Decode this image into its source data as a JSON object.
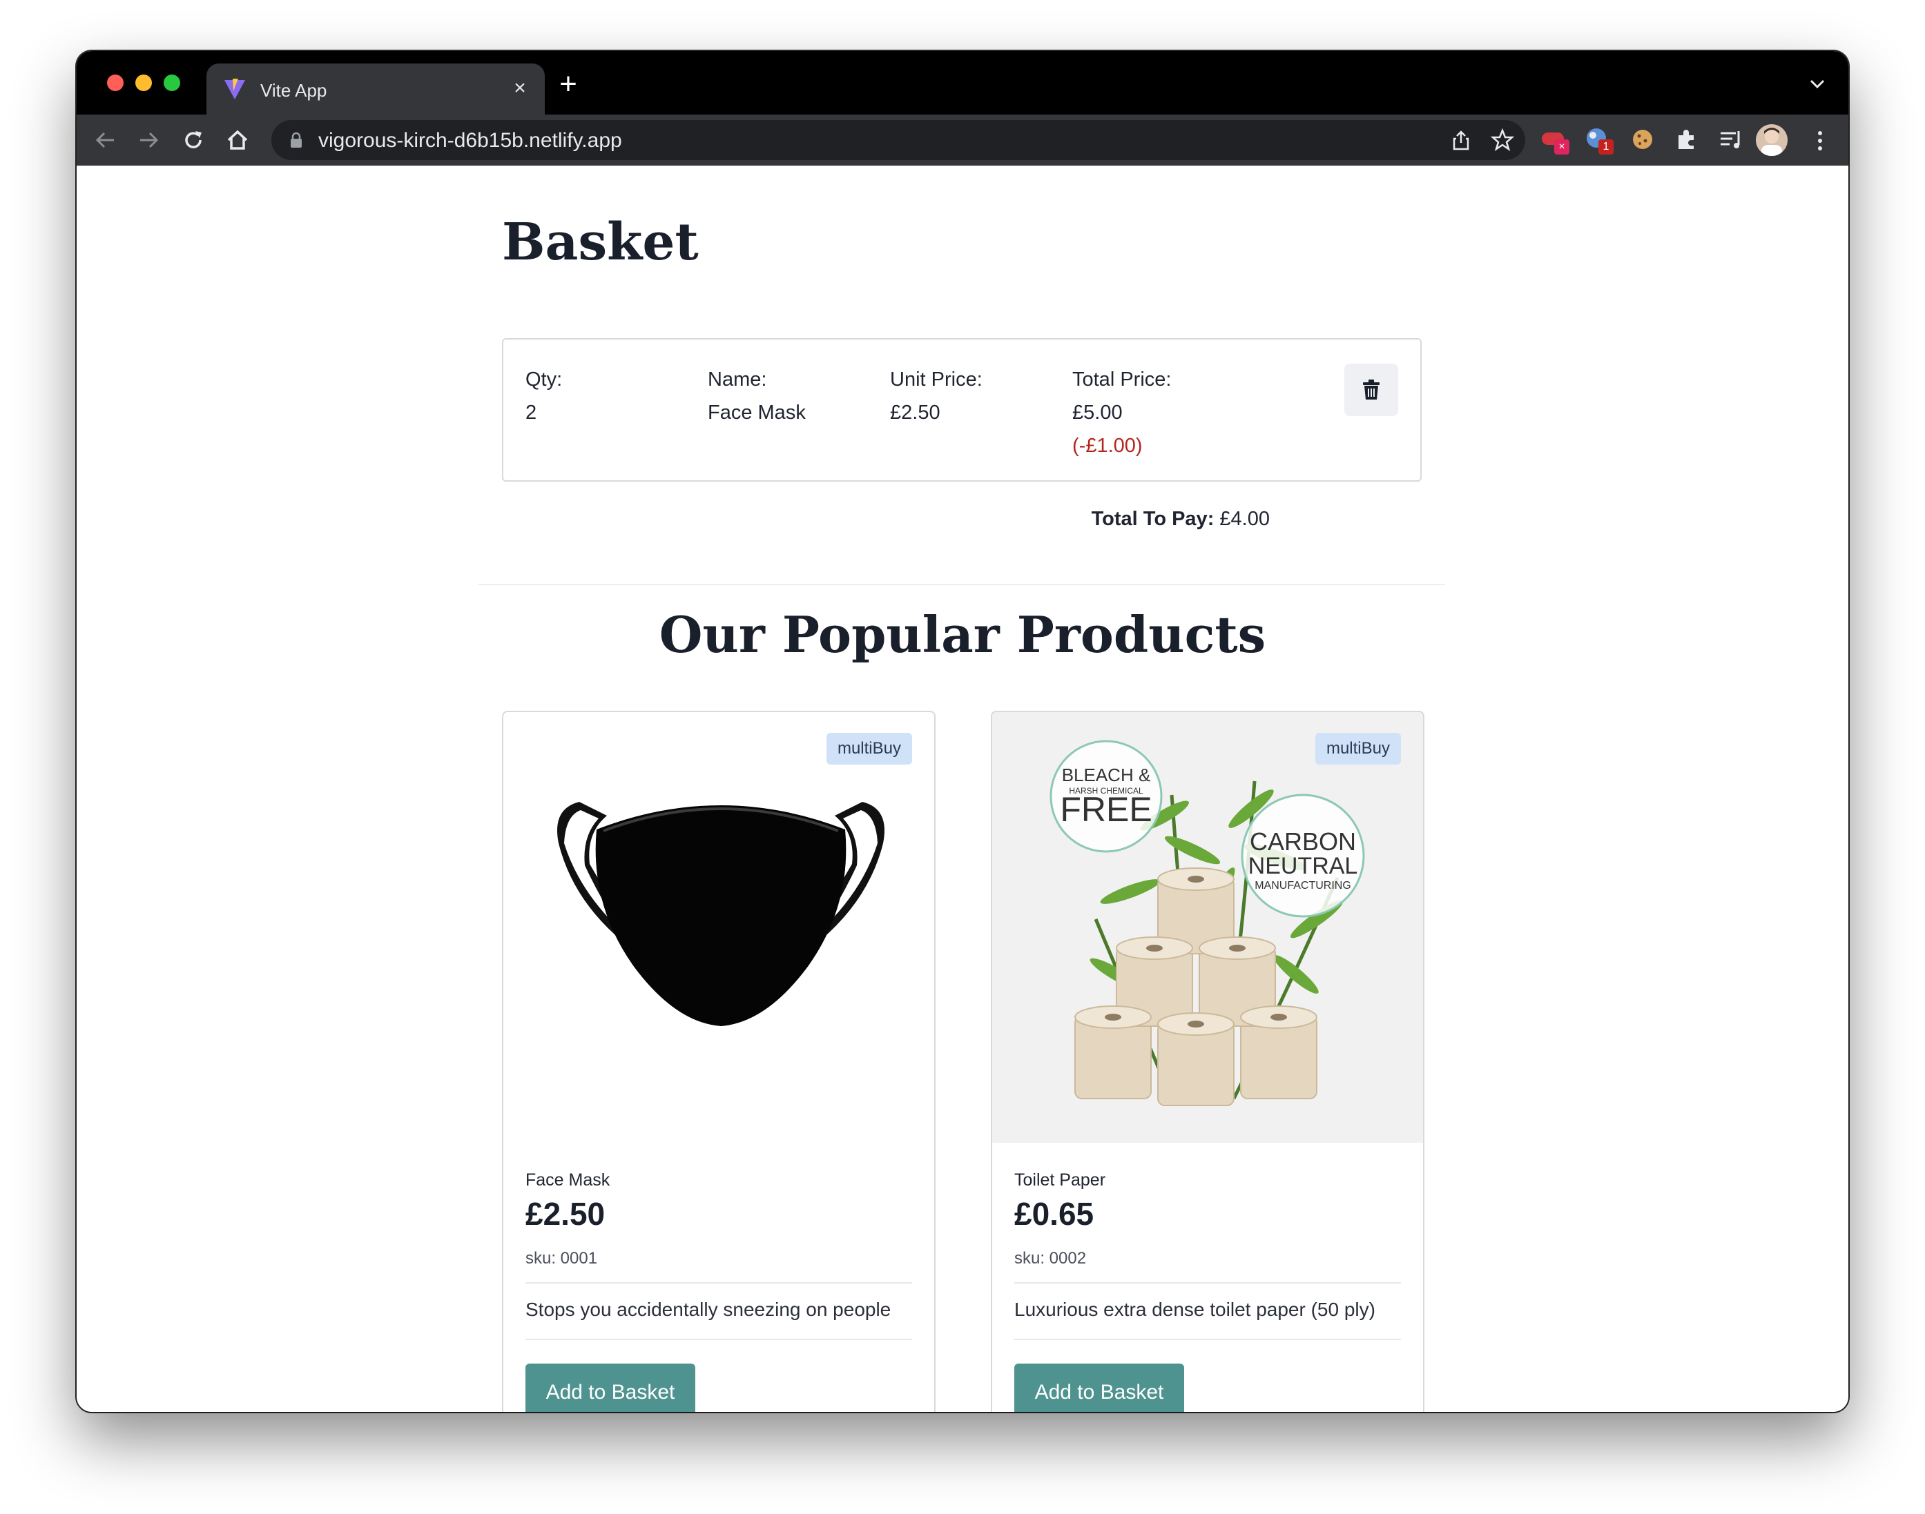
{
  "browser": {
    "tab_title": "Vite App",
    "url": "vigorous-kirch-d6b15b.netlify.app",
    "extension_badge": "1"
  },
  "basket": {
    "title": "Basket",
    "columns": {
      "qty_label": "Qty:",
      "name_label": "Name:",
      "unit_price_label": "Unit Price:",
      "total_price_label": "Total Price:"
    },
    "item": {
      "qty": "2",
      "name": "Face Mask",
      "unit_price": "£2.50",
      "total_price": "£5.00",
      "discount": "(-£1.00)"
    },
    "total_label": "Total To Pay:",
    "total_value": "£4.00"
  },
  "popular": {
    "title": "Our Popular Products",
    "products": [
      {
        "tag": "multiBuy",
        "name": "Face Mask",
        "price": "£2.50",
        "sku": "sku: 0001",
        "description": "Stops you accidentally sneezing on people",
        "button": "Add to Basket"
      },
      {
        "tag": "multiBuy",
        "name": "Toilet Paper",
        "price": "£0.65",
        "sku": "sku: 0002",
        "description": "Luxurious extra dense toilet paper (50 ply)",
        "button": "Add to Basket",
        "image_text": {
          "badge1_line1": "BLEACH &",
          "badge1_line2": "HARSH CHEMICAL",
          "badge1_line3": "FREE",
          "badge2_line1": "CARBON",
          "badge2_line2": "NEUTRAL",
          "badge2_line3": "MANUFACTURING"
        }
      }
    ]
  },
  "colors": {
    "accent_button": "#4f9390",
    "tag_bg": "#cfe2f7",
    "discount": "#b3261e"
  }
}
